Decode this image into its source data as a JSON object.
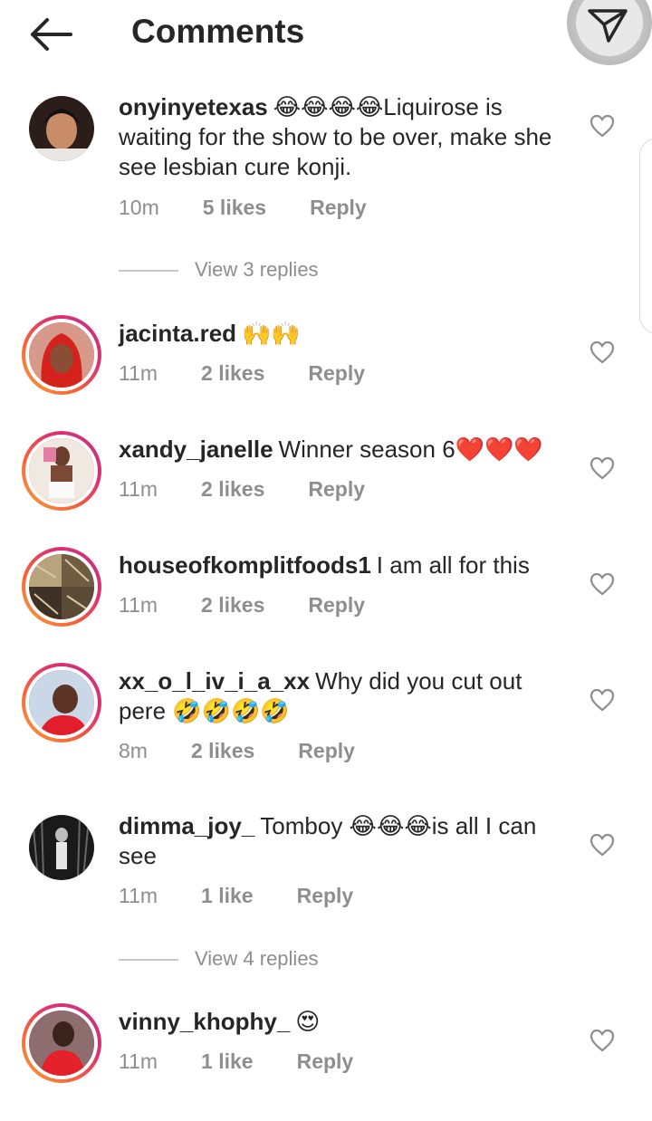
{
  "header": {
    "title": "Comments",
    "back_icon": "arrow-left-icon",
    "send_icon": "paper-plane-icon"
  },
  "comments": [
    {
      "username": "onyinyetexas",
      "text": "😂😂😂😂Liquirose is waiting for the show to be over, make she see lesbian cure konji.",
      "time": "10m",
      "likes": "5 likes",
      "reply": "Reply",
      "replies": "View 3 replies"
    },
    {
      "username": "jacinta.red",
      "text": "🙌🙌",
      "time": "11m",
      "likes": "2 likes",
      "reply": "Reply"
    },
    {
      "username": "xandy_janelle",
      "text": "Winner season 6❤️❤️❤️",
      "time": "11m",
      "likes": "2 likes",
      "reply": "Reply"
    },
    {
      "username": "houseofkomplitfoods1",
      "text": "I am all for this",
      "time": "11m",
      "likes": "2 likes",
      "reply": "Reply"
    },
    {
      "username": "xx_o_l_iv_i_a_xx",
      "text": "Why did you cut out pere 🤣🤣🤣🤣",
      "time": "8m",
      "likes": "2 likes",
      "reply": "Reply"
    },
    {
      "username": "dimma_joy_",
      "text": "Tomboy 😂😂😂is all I can see",
      "time": "11m",
      "likes": "1 like",
      "reply": "Reply",
      "replies": "View 4 replies"
    },
    {
      "username": "vinny_khophy_",
      "text": "😍",
      "time": "11m",
      "likes": "1 like",
      "reply": "Reply"
    }
  ]
}
